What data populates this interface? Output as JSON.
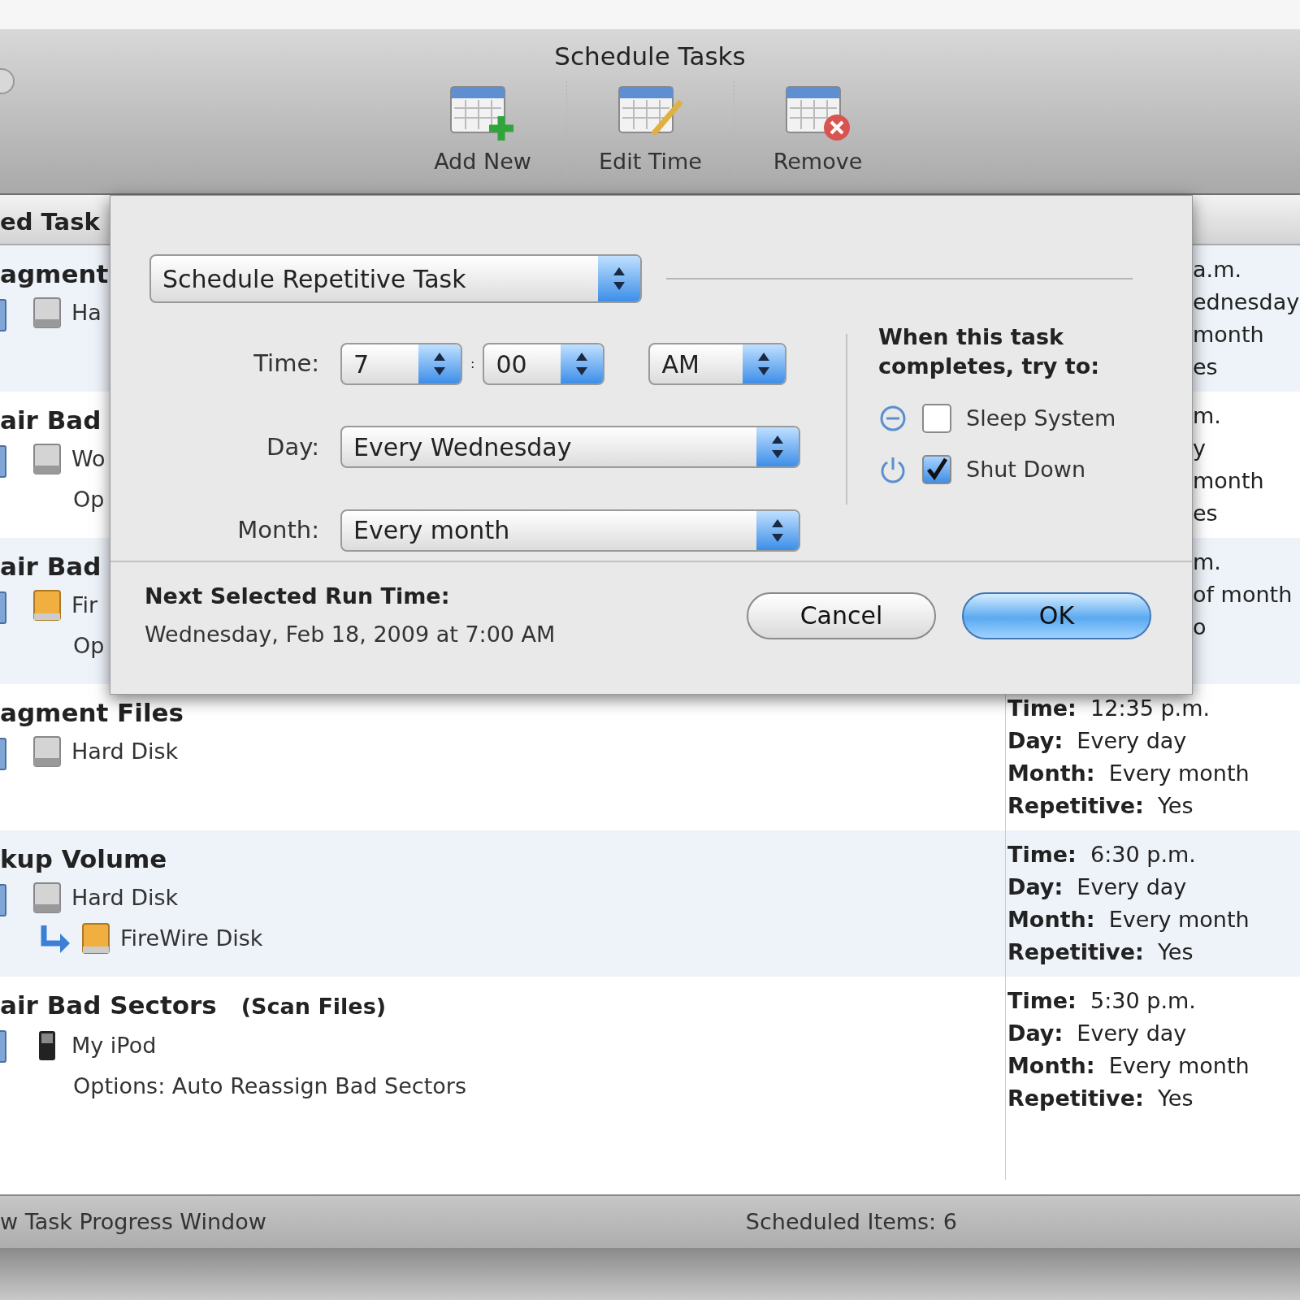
{
  "window": {
    "title": "Schedule Tasks"
  },
  "toolbar": [
    {
      "label": "Add New",
      "kind": "add"
    },
    {
      "label": "Edit Time",
      "kind": "edit"
    },
    {
      "label": "Remove",
      "kind": "remove"
    }
  ],
  "table": {
    "column_1": "ed Task",
    "rows": [
      {
        "covered": true,
        "title": "agment",
        "items": [
          {
            "kind": "disk",
            "text": "Ha"
          }
        ],
        "right": [
          "a.m.",
          "ednesday",
          "month",
          "es"
        ]
      },
      {
        "covered": true,
        "title": "air Bad",
        "items": [
          {
            "kind": "disk",
            "text": "Wo"
          },
          {
            "kind": "plain",
            "text": "Op"
          }
        ],
        "right": [
          "m.",
          "y",
          "month",
          "es"
        ]
      },
      {
        "covered": true,
        "title": "air Bad",
        "items": [
          {
            "kind": "firewire",
            "text": "Fir"
          },
          {
            "kind": "plain",
            "text": "Op"
          }
        ],
        "right": [
          "m.",
          "of month",
          "o"
        ]
      },
      {
        "covered": false,
        "title": "agment Files",
        "items": [
          {
            "kind": "disk",
            "text": "Hard Disk"
          }
        ],
        "schedule": [
          {
            "label": "Time:",
            "value": "12:35 p.m."
          },
          {
            "label": "Day:",
            "value": "Every day"
          },
          {
            "label": "Month:",
            "value": "Every month"
          },
          {
            "label": "Repetitive:",
            "value": "Yes"
          }
        ]
      },
      {
        "covered": false,
        "title": "kup Volume",
        "items": [
          {
            "kind": "disk",
            "text": "Hard Disk"
          },
          {
            "kind": "copy",
            "text": "FireWire Disk"
          }
        ],
        "schedule": [
          {
            "label": "Time:",
            "value": "6:30 p.m."
          },
          {
            "label": "Day:",
            "value": "Every day"
          },
          {
            "label": "Month:",
            "value": "Every month"
          },
          {
            "label": "Repetitive:",
            "value": "Yes"
          }
        ]
      },
      {
        "covered": false,
        "title": "air Bad Sectors",
        "note": "(Scan Files)",
        "items": [
          {
            "kind": "ipod",
            "text": "My iPod"
          },
          {
            "kind": "plain",
            "text": "Options: Auto Reassign Bad Sectors"
          }
        ],
        "schedule": [
          {
            "label": "Time:",
            "value": "5:30 p.m."
          },
          {
            "label": "Day:",
            "value": "Every day"
          },
          {
            "label": "Month:",
            "value": "Every month"
          },
          {
            "label": "Repetitive:",
            "value": "Yes"
          }
        ]
      }
    ]
  },
  "sheet": {
    "mode": "Schedule Repetitive Task",
    "time": {
      "label": "Time:",
      "hour": "7",
      "separator": ":",
      "minute": "00",
      "ampm": "AM"
    },
    "day": {
      "label": "Day:",
      "value": "Every Wednesday"
    },
    "month": {
      "label": "Month:",
      "value": "Every month"
    },
    "completion_heading": "When this task completes, try to:",
    "options": [
      {
        "kind": "sleep",
        "label": "Sleep System",
        "checked": false
      },
      {
        "kind": "shutdown",
        "label": "Shut Down",
        "checked": true
      }
    ],
    "next_run_label": "Next Selected Run Time:",
    "next_run_value": "Wednesday, Feb 18, 2009 at 7:00 AM",
    "buttons": [
      {
        "label": "Cancel",
        "kind": "cancel"
      },
      {
        "label": "OK",
        "kind": "default"
      }
    ]
  },
  "status_bar": {
    "left": "w Task Progress Window",
    "right": "Scheduled Items: 6"
  }
}
